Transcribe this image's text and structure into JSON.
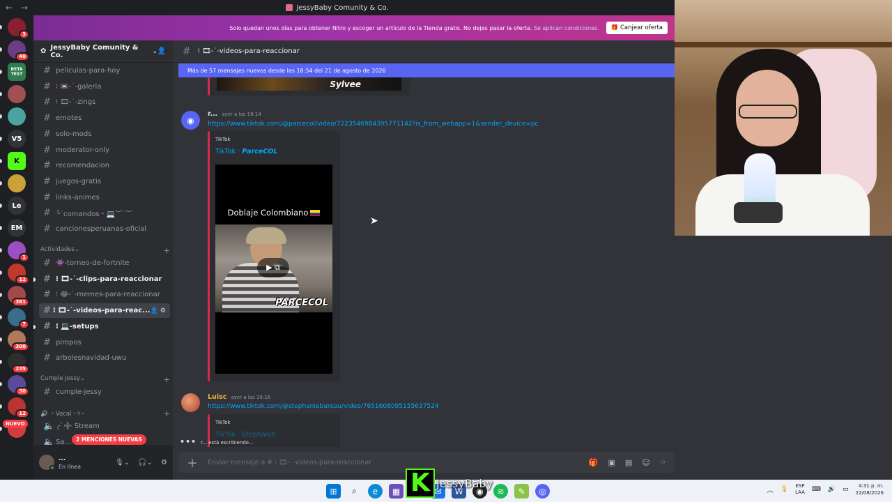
{
  "window": {
    "title": "JessyBaby Comunity & Co.",
    "back": "←",
    "forward": "→"
  },
  "servers": [
    {
      "label": "",
      "color": "#8a1f2f",
      "badge": "3"
    },
    {
      "label": "",
      "color": "#6a3d86",
      "badge": "40"
    },
    {
      "label": "BETA TEST",
      "color": "#2e7d4f",
      "badge": ""
    },
    {
      "label": "",
      "color": "#a05050",
      "badge": ""
    },
    {
      "label": "",
      "color": "#4aa3a0",
      "badge": ""
    },
    {
      "label": "V5",
      "color": "#313338",
      "badge": ""
    },
    {
      "label": "K",
      "color": "#53fc18",
      "badge": ""
    },
    {
      "label": "",
      "color": "#c9a23a",
      "badge": ""
    },
    {
      "label": "Le",
      "color": "#313338",
      "badge": ""
    },
    {
      "label": "EM",
      "color": "#313338",
      "badge": ""
    },
    {
      "label": "",
      "color": "#9b4fc2",
      "badge": "1"
    },
    {
      "label": "",
      "color": "#c0392b",
      "badge": "12"
    },
    {
      "label": "",
      "color": "#a24a4a",
      "badge": "361"
    },
    {
      "label": "",
      "color": "#3a6d8a",
      "badge": "7"
    },
    {
      "label": "",
      "color": "#b07a5a",
      "badge": "300"
    },
    {
      "label": "",
      "color": "#2e2e2e",
      "badge": "235"
    },
    {
      "label": "",
      "color": "#5a4a9a",
      "badge": "30"
    },
    {
      "label": "",
      "color": "#b33",
      "badge": "12"
    },
    {
      "label": "",
      "color": "#d23c3c",
      "badge": ""
    }
  ],
  "nuevo_badge": "NUEVO",
  "nitro": {
    "message": "Solo quedan unos días para obtener Nitro y escoger un artículo de la Tienda gratis. No dejes pasar la oferta.",
    "link": "Se aplican condiciones.",
    "button": "Canjear oferta"
  },
  "guild": {
    "name": "JessyBaby Comunity & Co."
  },
  "channels_top": [
    {
      "name": "peliculas-para-hoy",
      "bold": false
    },
    {
      "name": "⁝ 📼-˙-galeria",
      "bold": false
    },
    {
      "name": "⁝ 🎞-˙-zings",
      "bold": false
    },
    {
      "name": "emotes",
      "bold": false
    },
    {
      "name": "solo-mods",
      "bold": false
    },
    {
      "name": "moderator-only",
      "bold": false
    },
    {
      "name": "recomendacion",
      "bold": false
    },
    {
      "name": "juegos-gratis",
      "bold": false
    },
    {
      "name": "links-animes",
      "bold": false
    },
    {
      "name": "╰˙comandos・💻︶˙︶",
      "bold": false
    },
    {
      "name": "cancionesperuanas-oficial",
      "bold": false
    }
  ],
  "category_actividades": "Actividades",
  "channels_act": [
    {
      "name": "👾-torneo-de-fortnite",
      "bold": false,
      "sel": false
    },
    {
      "name": "⁝ 🎞-˙-clips-para-reaccionar",
      "bold": true,
      "sel": false
    },
    {
      "name": "⁝ 😂-˙-memes-para-reaccionar",
      "bold": false,
      "sel": false
    },
    {
      "name": "⁝ 🎞-˙-videos-para-reac...",
      "bold": true,
      "sel": true
    },
    {
      "name": "⁝ 💻-setups",
      "bold": true,
      "sel": false
    },
    {
      "name": "piropos",
      "bold": false,
      "sel": false
    },
    {
      "name": "arbolesnavidad-uwu",
      "bold": false,
      "sel": false
    }
  ],
  "category_cumple": "Cumple Jessy",
  "channels_cumple": [
    {
      "name": "cumple-jessy"
    }
  ],
  "category_vocal": "🔊 ・Vocal・୨",
  "voice_channels": [
    {
      "name": "╭˙➕ Stream"
    },
    {
      "name": "Sa..."
    }
  ],
  "mentions_badge": "2 MENCIONES NUEVAS",
  "user": {
    "name": "...",
    "status": "En línea"
  },
  "channel": {
    "name": "⁝ 🎞-˙-videos-para-reaccionar"
  },
  "new_messages_bar": "Más de 57 mensajes nuevos desde las 18:54 del 21 de agosto de 2026",
  "top_embed_text": "Sylvee",
  "messages": [
    {
      "author": "r...",
      "author_color": "#dbdee1",
      "time": "ayer a las 19:14",
      "link": "https://www.tiktok.com/@parcecol/video/7223546984395771142?is_from_webapp=1&sender_device=pc",
      "embed_provider": "TikTok",
      "embed_title_prefix": "TikTok · ",
      "embed_title_name": "𝙋𝙖𝙧𝙘𝙚𝘾𝙊𝙇",
      "video_caption": "Doblaje Colombiano",
      "video_logo": "PARCECOL"
    },
    {
      "author": "Luisc",
      "author_color": "#f0b232",
      "time": "ayer a las 19:16",
      "link": "https://www.tiktok.com/@stephaniebureau/video/7651608095155637524",
      "embed_provider": "TikTok",
      "embed_title": "TikTok · Stéphanie"
    }
  ],
  "typing": {
    "user": "r...",
    "text": "está escribiendo..."
  },
  "composer": {
    "placeholder": "Enviar mensaje a # ⁝ 🎞-˙-videos-para-reaccionar"
  },
  "stream_overlay": {
    "logo": "K",
    "name": "JessyBaby"
  },
  "taskbar": {
    "lang_top": "ESP",
    "lang_bottom": "LAA",
    "time": "4:31 p. m.",
    "date": "22/08/2026"
  }
}
